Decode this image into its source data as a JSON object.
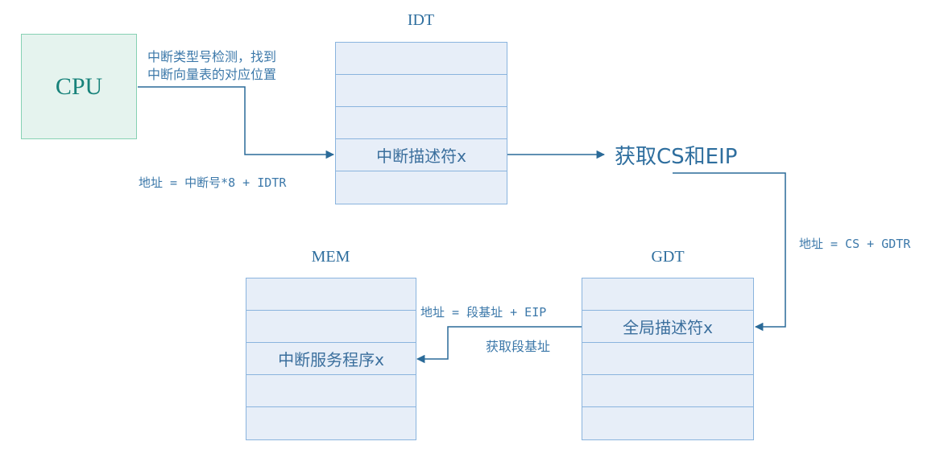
{
  "cpu": {
    "label": "CPU"
  },
  "idt": {
    "title": "IDT",
    "rows": [
      "",
      "",
      "",
      "中断描述符x",
      ""
    ],
    "highlight_row": 3
  },
  "gdt": {
    "title": "GDT",
    "rows": [
      "",
      "全局描述符x",
      "",
      "",
      ""
    ],
    "highlight_row": 1
  },
  "mem": {
    "title": "MEM",
    "rows": [
      "",
      "",
      "中断服务程序x",
      "",
      ""
    ],
    "highlight_row": 2
  },
  "annotations": {
    "cpu_to_idt_line1": "中断类型号检测，找到",
    "cpu_to_idt_line2": "中断向量表的对应位置",
    "idt_address": "地址 = 中断号*8 + IDTR",
    "get_cs_eip": "获取CS和EIP",
    "gdt_address": "地址 = CS + GDTR",
    "mem_address": "地址 = 段基址 + EIP",
    "get_segment_base": "获取段基址"
  },
  "colors": {
    "connector": "#2a6a98",
    "table_fill": "#e7eef8",
    "table_border": "#8ab4de",
    "cpu_fill": "#e5f3ee",
    "cpu_border": "#86d1b3",
    "cpu_text": "#17827a"
  }
}
